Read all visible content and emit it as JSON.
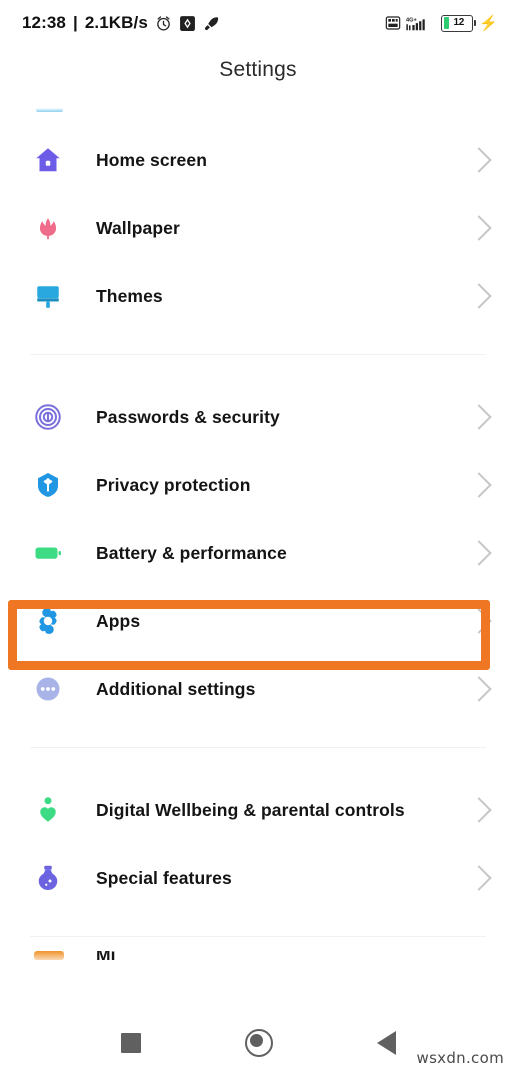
{
  "status_bar": {
    "time": "12:38",
    "separator": "|",
    "network_speed": "2.1KB/s",
    "left_icons": [
      "alarm-clock-icon",
      "screenshot-icon",
      "rocket-icon"
    ],
    "right_icons": [
      "vowifi-icon",
      "signal-4g-icon"
    ],
    "network_type": "4G+",
    "battery_level": "12",
    "charging": true
  },
  "header": {
    "title": "Settings"
  },
  "groups": [
    {
      "id": "personalization",
      "items": [
        {
          "label": "Home screen",
          "icon": "home-icon",
          "color": "#6c5ce7"
        },
        {
          "label": "Wallpaper",
          "icon": "tulip-icon",
          "color": "#ef6d8a"
        },
        {
          "label": "Themes",
          "icon": "paintbrush-icon",
          "color": "#29a8e0"
        }
      ]
    },
    {
      "id": "system",
      "items": [
        {
          "label": "Passwords & security",
          "icon": "fingerprint-icon",
          "color": "#7b6fdc"
        },
        {
          "label": "Privacy protection",
          "icon": "shield-icon",
          "color": "#2196e3"
        },
        {
          "label": "Battery & performance",
          "icon": "battery-icon",
          "color": "#3ddc84"
        },
        {
          "label": "Apps",
          "icon": "gear-icon",
          "color": "#2196e3",
          "highlighted": true
        },
        {
          "label": "Additional settings",
          "icon": "more-dots-icon",
          "color": "#a8b4e8"
        }
      ]
    },
    {
      "id": "wellbeing",
      "items": [
        {
          "label": "Digital Wellbeing & parental controls",
          "icon": "heart-person-icon",
          "color": "#3ddc84"
        },
        {
          "label": "Special features",
          "icon": "potion-icon",
          "color": "#6c63e0"
        }
      ]
    }
  ],
  "partial_bottom": {
    "label": "Mi",
    "icon": "mi-account-icon",
    "color": "#f0932b"
  },
  "highlight": {
    "target": "Apps",
    "color": "#ef7622"
  },
  "nav_bar": {
    "recent_label": "recent-apps",
    "home_label": "home",
    "back_label": "back"
  },
  "watermark": {
    "text": "wsxdn.com"
  }
}
